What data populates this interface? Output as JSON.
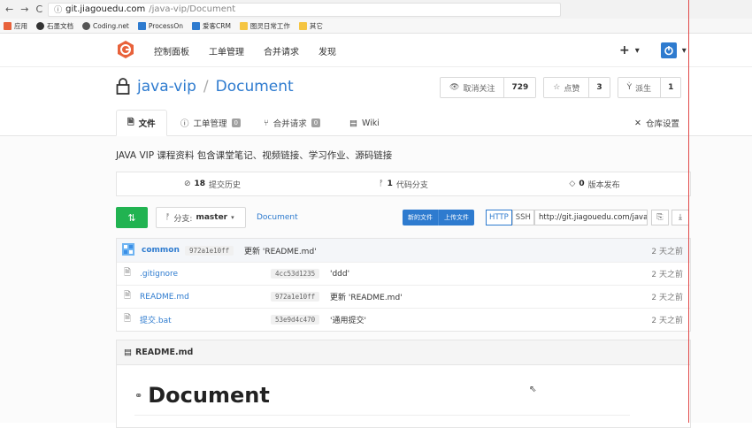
{
  "browser": {
    "url_host": "git.jiagouedu.com",
    "url_path": "/java-vip/Document"
  },
  "bookmarks": [
    {
      "label": "应用",
      "color": "#e8623b"
    },
    {
      "label": "石墨文档",
      "color": "#333333"
    },
    {
      "label": "Coding.net",
      "color": "#555555"
    },
    {
      "label": "ProcessOn",
      "color": "#2e7bcf"
    },
    {
      "label": "爱客CRM",
      "color": "#2e7bcf"
    },
    {
      "label": "图灵日常工作",
      "color": "#f5c542"
    },
    {
      "label": "其它",
      "color": "#f5c542"
    }
  ],
  "topnav": {
    "menu": [
      "控制面板",
      "工单管理",
      "合并请求",
      "发现"
    ],
    "plus": "+",
    "caret": "▾"
  },
  "repo": {
    "owner": "java-vip",
    "separator": "/",
    "name": "Document",
    "actions": [
      {
        "label": "取消关注",
        "icon": "eye-icon",
        "count": "729"
      },
      {
        "label": "点赞",
        "icon": "star-icon",
        "count": "3"
      },
      {
        "label": "派生",
        "icon": "fork-icon",
        "count": "1"
      }
    ]
  },
  "tabs": [
    {
      "label": "文件",
      "icon": "file-icon",
      "active": true
    },
    {
      "label": "工单管理",
      "icon": "issue-icon",
      "badge": "0"
    },
    {
      "label": "合并请求",
      "icon": "pull-request-icon",
      "badge": "0"
    },
    {
      "label": "Wiki",
      "icon": "wiki-icon"
    }
  ],
  "settings_label": "仓库设置",
  "description": "JAVA VIP 课程资料 包含课堂笔记、视频链接、学习作业、源码链接",
  "stats": {
    "commits_count": "18",
    "commits_label": "提交历史",
    "branches_count": "1",
    "branches_label": "代码分支",
    "releases_count": "0",
    "releases_label": "版本发布"
  },
  "toolbar": {
    "branch_prefix": "分支:",
    "branch_name": "master",
    "branch_caret": "▾",
    "breadcrumb": "Document",
    "new_file": "新的文件",
    "upload_file": "上传文件",
    "protocol_http": "HTTP",
    "protocol_ssh": "SSH",
    "clone_url": "http://git.jiagouedu.com/java-vip/Document.git"
  },
  "files": {
    "latest": {
      "author": "common",
      "hash": "972a1e10ff",
      "message": "更新 'README.md'",
      "time": "2 天之前"
    },
    "rows": [
      {
        "name": ".gitignore",
        "hash": "4cc53d1235",
        "message": "'ddd'",
        "time": "2 天之前"
      },
      {
        "name": "README.md",
        "hash": "972a1e10ff",
        "message": "更新 'README.md'",
        "time": "2 天之前"
      },
      {
        "name": "提交.bat",
        "hash": "53e9d4c470",
        "message": "'通用提交'",
        "time": "2 天之前"
      }
    ]
  },
  "readme": {
    "file_label": "README.md",
    "heading": "Document"
  }
}
